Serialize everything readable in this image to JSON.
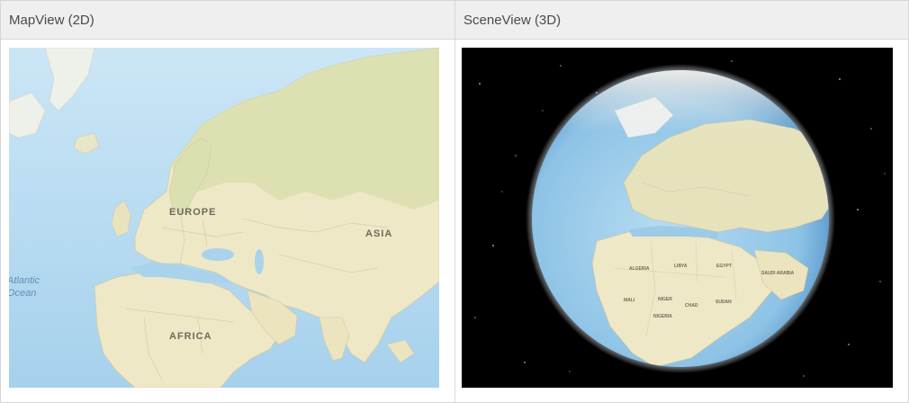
{
  "panels": [
    {
      "title": "MapView (2D)",
      "labels": {
        "europe": "EUROPE",
        "asia": "ASIA",
        "africa": "AFRICA",
        "atlantic_line1": "Atlantic",
        "atlantic_line2": "Ocean"
      }
    },
    {
      "title": "SceneView (3D)",
      "labels": {
        "algeria": "ALGERIA",
        "libya": "LIBYA",
        "egypt": "EGYPT",
        "saudi_arabia": "SAUDI ARABIA",
        "mali": "MALI",
        "niger": "NIGER",
        "chad": "CHAD",
        "sudan": "SUDAN",
        "nigeria": "NIGERIA"
      }
    }
  ],
  "colors": {
    "ocean": "#a9d3ec",
    "land": "#efe8c6",
    "land_green": "#d9dfae",
    "space": "#000000",
    "header_bg": "#efefef"
  }
}
